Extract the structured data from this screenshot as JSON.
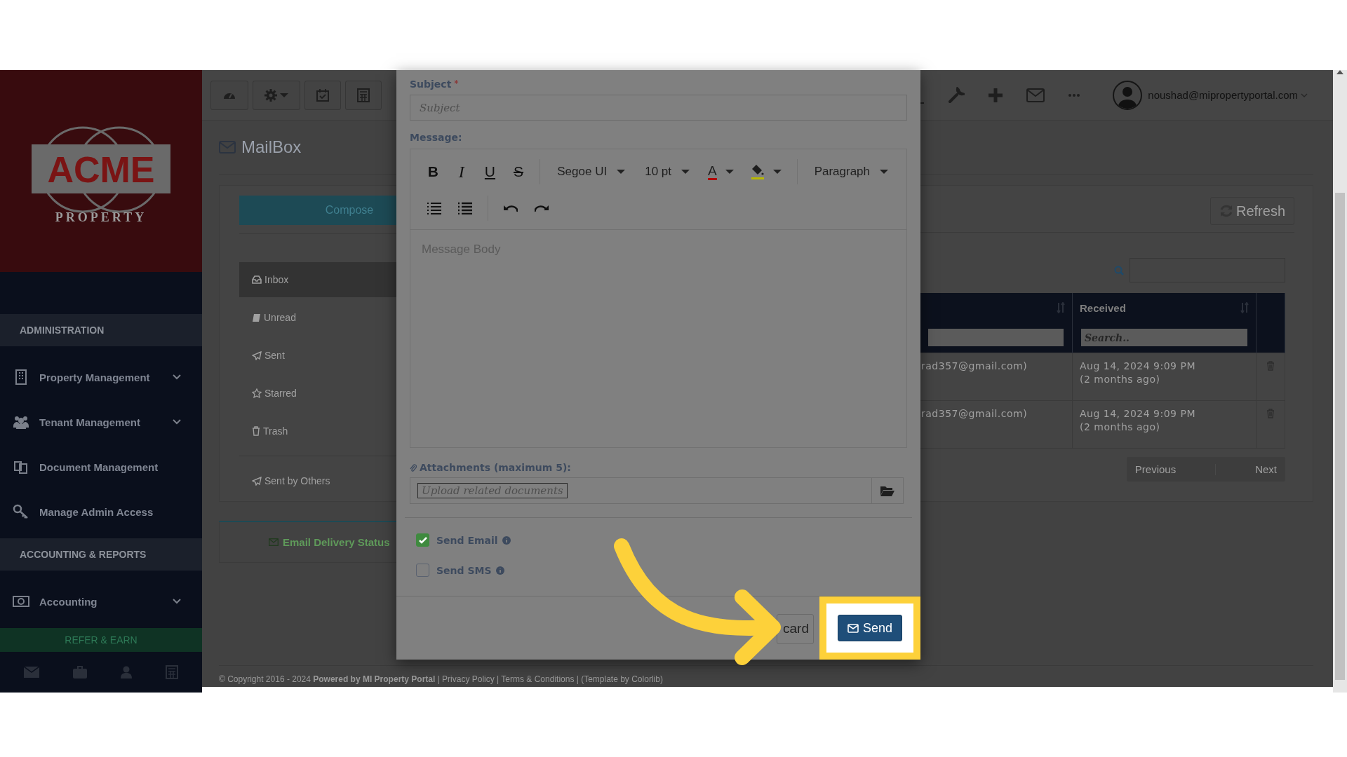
{
  "sidebar": {
    "logo": {
      "wordmark": "ACME",
      "tagline": "PROPERTY"
    },
    "sections": [
      {
        "heading": "ADMINISTRATION",
        "items": [
          {
            "label": "Property Management",
            "kind": "building",
            "expandable": true
          },
          {
            "label": "Tenant Management",
            "kind": "people",
            "expandable": true
          },
          {
            "label": "Document Management",
            "kind": "documents",
            "expandable": false
          },
          {
            "label": "Manage Admin Access",
            "kind": "key",
            "expandable": false
          }
        ]
      },
      {
        "heading": "ACCOUNTING & REPORTS",
        "items": [
          {
            "label": "Accounting",
            "kind": "money",
            "expandable": true
          }
        ]
      }
    ],
    "refer_button": "REFER & EARN"
  },
  "topbar": {
    "user_email": "noushad@mipropertyportal.com"
  },
  "mailbox": {
    "title": "MailBox",
    "compose_button": "Compose",
    "folders": [
      {
        "label": "Inbox",
        "kind": "inbox",
        "selected": true
      },
      {
        "label": "Unread",
        "kind": "book",
        "selected": false
      },
      {
        "label": "Sent",
        "kind": "send",
        "selected": false
      },
      {
        "label": "Starred",
        "kind": "star",
        "selected": false
      },
      {
        "label": "Trash",
        "kind": "trash",
        "selected": false
      }
    ],
    "other_folders": [
      {
        "label": "Sent by Others",
        "kind": "send",
        "selected": false
      }
    ],
    "delivery_status_button": "Email Delivery Status"
  },
  "messages": {
    "refresh_button": "Refresh",
    "received_column": {
      "label": "Received",
      "filter_placeholder": "Search.."
    },
    "rows": [
      {
        "column_1": "rad357@gmail.com)",
        "received": "Aug 14, 2024 9:09 PM",
        "received_ago": "(2 months ago)"
      },
      {
        "column_1": "rad357@gmail.com)",
        "received": "Aug 14, 2024 9:09 PM",
        "received_ago": "(2 months ago)"
      }
    ],
    "pagination": {
      "previous": "Previous",
      "next": "Next"
    }
  },
  "footer": {
    "text": "© Copyright 2016 - 2024 **Powered by MI Property Portal** | Privacy Policy | Terms & Conditions | (Template by Colorlib)"
  },
  "compose_modal": {
    "subject_label": "Subject",
    "required_mark": "*",
    "subject_placeholder": "Subject",
    "message_label": "Message:",
    "format_buttons": [
      "B",
      "I",
      "U",
      "S"
    ],
    "font_family": "Segoe UI",
    "font_size": "10 pt",
    "text_color_button": "A",
    "block_format": "Paragraph",
    "body_placeholder": "Message Body",
    "attachments_label": "Attachments (maximum 5):",
    "upload_placeholder": "Upload related documents",
    "options": [
      {
        "label": "Send Email",
        "checked": true
      },
      {
        "label": "Send SMS",
        "checked": false
      }
    ],
    "discard_button": "card",
    "send_button": "Send"
  }
}
